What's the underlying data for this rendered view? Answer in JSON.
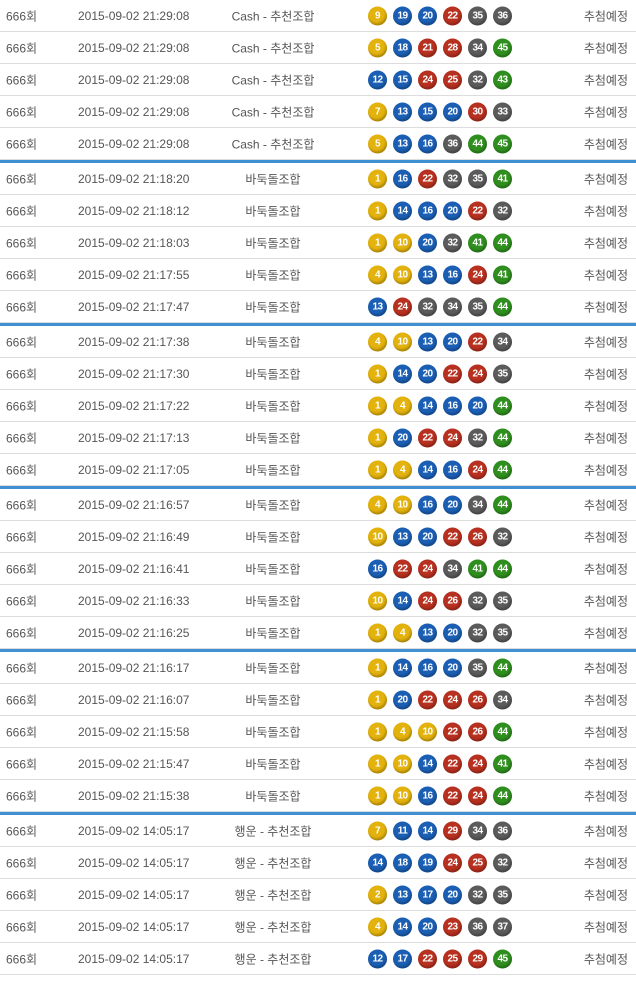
{
  "ball_colors": {
    "yellow": "#e3b20c",
    "blue": "#1b5fb5",
    "red": "#b8301f",
    "gray": "#5b5b5b",
    "green": "#2f8f1e"
  },
  "group_separator_color": "#3f8fd2",
  "rows": [
    {
      "round": "666회",
      "time": "2015-09-02 21:29:08",
      "method": "Cash - 추천조합",
      "numbers": [
        9,
        19,
        20,
        22,
        35,
        36
      ],
      "status": "추첨예정"
    },
    {
      "round": "666회",
      "time": "2015-09-02 21:29:08",
      "method": "Cash - 추천조합",
      "numbers": [
        5,
        18,
        21,
        28,
        34,
        45
      ],
      "status": "추첨예정"
    },
    {
      "round": "666회",
      "time": "2015-09-02 21:29:08",
      "method": "Cash - 추천조합",
      "numbers": [
        12,
        15,
        24,
        25,
        32,
        43
      ],
      "status": "추첨예정"
    },
    {
      "round": "666회",
      "time": "2015-09-02 21:29:08",
      "method": "Cash - 추천조합",
      "numbers": [
        7,
        13,
        15,
        20,
        30,
        33
      ],
      "status": "추첨예정"
    },
    {
      "round": "666회",
      "time": "2015-09-02 21:29:08",
      "method": "Cash - 추천조합",
      "numbers": [
        5,
        13,
        16,
        36,
        44,
        45
      ],
      "status": "추첨예정"
    },
    {
      "round": "666회",
      "time": "2015-09-02 21:18:20",
      "method": "바둑돌조합",
      "numbers": [
        1,
        16,
        22,
        32,
        35,
        41
      ],
      "status": "추첨예정"
    },
    {
      "round": "666회",
      "time": "2015-09-02 21:18:12",
      "method": "바둑돌조합",
      "numbers": [
        1,
        14,
        16,
        20,
        22,
        32
      ],
      "status": "추첨예정"
    },
    {
      "round": "666회",
      "time": "2015-09-02 21:18:03",
      "method": "바둑돌조합",
      "numbers": [
        1,
        10,
        20,
        32,
        41,
        44
      ],
      "status": "추첨예정"
    },
    {
      "round": "666회",
      "time": "2015-09-02 21:17:55",
      "method": "바둑돌조합",
      "numbers": [
        4,
        10,
        13,
        16,
        24,
        41
      ],
      "status": "추첨예정"
    },
    {
      "round": "666회",
      "time": "2015-09-02 21:17:47",
      "method": "바둑돌조합",
      "numbers": [
        13,
        24,
        32,
        34,
        35,
        44
      ],
      "status": "추첨예정"
    },
    {
      "round": "666회",
      "time": "2015-09-02 21:17:38",
      "method": "바둑돌조합",
      "numbers": [
        4,
        10,
        13,
        20,
        22,
        34
      ],
      "status": "추첨예정"
    },
    {
      "round": "666회",
      "time": "2015-09-02 21:17:30",
      "method": "바둑돌조합",
      "numbers": [
        1,
        14,
        20,
        22,
        24,
        35
      ],
      "status": "추첨예정"
    },
    {
      "round": "666회",
      "time": "2015-09-02 21:17:22",
      "method": "바둑돌조합",
      "numbers": [
        1,
        4,
        14,
        16,
        20,
        44
      ],
      "status": "추첨예정"
    },
    {
      "round": "666회",
      "time": "2015-09-02 21:17:13",
      "method": "바둑돌조합",
      "numbers": [
        1,
        20,
        22,
        24,
        32,
        44
      ],
      "status": "추첨예정"
    },
    {
      "round": "666회",
      "time": "2015-09-02 21:17:05",
      "method": "바둑돌조합",
      "numbers": [
        1,
        4,
        14,
        16,
        24,
        44
      ],
      "status": "추첨예정"
    },
    {
      "round": "666회",
      "time": "2015-09-02 21:16:57",
      "method": "바둑돌조합",
      "numbers": [
        4,
        10,
        16,
        20,
        34,
        44
      ],
      "status": "추첨예정"
    },
    {
      "round": "666회",
      "time": "2015-09-02 21:16:49",
      "method": "바둑돌조합",
      "numbers": [
        10,
        13,
        20,
        22,
        26,
        32
      ],
      "status": "추첨예정"
    },
    {
      "round": "666회",
      "time": "2015-09-02 21:16:41",
      "method": "바둑돌조합",
      "numbers": [
        16,
        22,
        24,
        34,
        41,
        44
      ],
      "status": "추첨예정"
    },
    {
      "round": "666회",
      "time": "2015-09-02 21:16:33",
      "method": "바둑돌조합",
      "numbers": [
        10,
        14,
        24,
        26,
        32,
        35
      ],
      "status": "추첨예정"
    },
    {
      "round": "666회",
      "time": "2015-09-02 21:16:25",
      "method": "바둑돌조합",
      "numbers": [
        1,
        4,
        13,
        20,
        32,
        35
      ],
      "status": "추첨예정"
    },
    {
      "round": "666회",
      "time": "2015-09-02 21:16:17",
      "method": "바둑돌조합",
      "numbers": [
        1,
        14,
        16,
        20,
        35,
        44
      ],
      "status": "추첨예정"
    },
    {
      "round": "666회",
      "time": "2015-09-02 21:16:07",
      "method": "바둑돌조합",
      "numbers": [
        1,
        20,
        22,
        24,
        26,
        34
      ],
      "status": "추첨예정"
    },
    {
      "round": "666회",
      "time": "2015-09-02 21:15:58",
      "method": "바둑돌조합",
      "numbers": [
        1,
        4,
        10,
        22,
        26,
        44
      ],
      "status": "추첨예정"
    },
    {
      "round": "666회",
      "time": "2015-09-02 21:15:47",
      "method": "바둑돌조합",
      "numbers": [
        1,
        10,
        14,
        22,
        24,
        41
      ],
      "status": "추첨예정"
    },
    {
      "round": "666회",
      "time": "2015-09-02 21:15:38",
      "method": "바둑돌조합",
      "numbers": [
        1,
        10,
        16,
        22,
        24,
        44
      ],
      "status": "추첨예정"
    },
    {
      "round": "666회",
      "time": "2015-09-02 14:05:17",
      "method": "행운 - 추천조합",
      "numbers": [
        7,
        11,
        14,
        29,
        34,
        36
      ],
      "status": "추첨예정"
    },
    {
      "round": "666회",
      "time": "2015-09-02 14:05:17",
      "method": "행운 - 추천조합",
      "numbers": [
        14,
        18,
        19,
        24,
        25,
        32
      ],
      "status": "추첨예정"
    },
    {
      "round": "666회",
      "time": "2015-09-02 14:05:17",
      "method": "행운 - 추천조합",
      "numbers": [
        2,
        13,
        17,
        20,
        32,
        35
      ],
      "status": "추첨예정"
    },
    {
      "round": "666회",
      "time": "2015-09-02 14:05:17",
      "method": "행운 - 추천조합",
      "numbers": [
        4,
        14,
        20,
        23,
        36,
        37
      ],
      "status": "추첨예정"
    },
    {
      "round": "666회",
      "time": "2015-09-02 14:05:17",
      "method": "행운 - 추천조합",
      "numbers": [
        12,
        17,
        22,
        25,
        29,
        45
      ],
      "status": "추첨예정"
    }
  ]
}
